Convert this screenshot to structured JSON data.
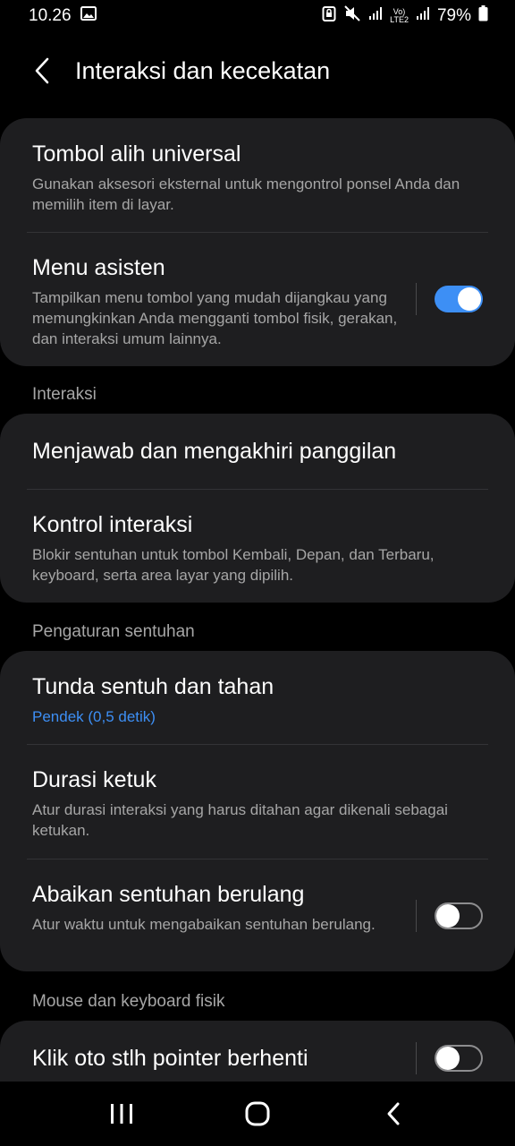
{
  "status": {
    "time": "10.26",
    "network_top": "Vo)",
    "network_bottom": "LTE2",
    "battery": "79%"
  },
  "header": {
    "title": "Interaksi dan kecekatan"
  },
  "card1": {
    "item1": {
      "title": "Tombol alih universal",
      "sub": "Gunakan aksesori eksternal untuk mengontrol ponsel Anda dan memilih item di layar."
    },
    "item2": {
      "title": "Menu asisten",
      "sub": "Tampilkan menu tombol yang mudah dijangkau yang memungkinkan Anda mengganti tombol fisik, gerakan, dan interaksi umum lainnya.",
      "toggle": "on"
    }
  },
  "section_interaksi": "Interaksi",
  "card2": {
    "item1": {
      "title": "Menjawab dan mengakhiri panggilan"
    },
    "item2": {
      "title": "Kontrol interaksi",
      "sub": "Blokir sentuhan untuk tombol Kembali, Depan, dan Terbaru, keyboard, serta area layar yang dipilih."
    }
  },
  "section_sentuhan": "Pengaturan sentuhan",
  "card3": {
    "item1": {
      "title": "Tunda sentuh dan tahan",
      "sub": "Pendek (0,5 detik)"
    },
    "item2": {
      "title": "Durasi ketuk",
      "sub": "Atur durasi interaksi yang harus ditahan agar dikenali sebagai ketukan."
    },
    "item3": {
      "title": "Abaikan sentuhan berulang",
      "sub": "Atur waktu untuk mengabaikan sentuhan berulang.",
      "toggle": "off"
    }
  },
  "section_mouse": "Mouse dan keyboard fisik",
  "card4": {
    "item1": {
      "title": "Klik oto stlh pointer berhenti",
      "toggle": "off"
    }
  },
  "colors": {
    "accent": "#3d8ff5",
    "card": "#1e1e20",
    "background": "#000000"
  }
}
